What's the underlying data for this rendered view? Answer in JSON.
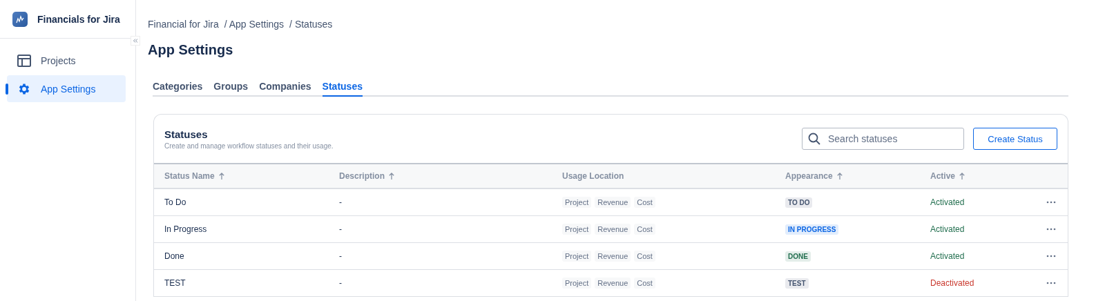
{
  "app": {
    "name": "Financials for Jira"
  },
  "sidebar": {
    "items": [
      {
        "label": "Projects",
        "selected": false
      },
      {
        "label": "App Settings",
        "selected": true
      }
    ]
  },
  "breadcrumbs": [
    "Financial for Jira",
    "/ App Settings",
    "/ Statuses"
  ],
  "page_title": "App Settings",
  "tabs": [
    {
      "label": "Categories",
      "selected": false
    },
    {
      "label": "Groups",
      "selected": false
    },
    {
      "label": "Companies",
      "selected": false
    },
    {
      "label": "Statuses",
      "selected": true
    }
  ],
  "card": {
    "title": "Statuses",
    "subtitle": "Create and manage workflow statuses and their usage.",
    "search": {
      "placeholder": "Search statuses"
    },
    "create_button": "Create Status"
  },
  "table": {
    "columns": [
      {
        "label": "Status Name",
        "sortable": true
      },
      {
        "label": "Description",
        "sortable": true
      },
      {
        "label": "Usage Location",
        "sortable": false
      },
      {
        "label": "Appearance",
        "sortable": true
      },
      {
        "label": "Active",
        "sortable": true
      }
    ],
    "rows": [
      {
        "name": "To Do",
        "description": "-",
        "usage": [
          "Project",
          "Revenue",
          "Cost"
        ],
        "appearance": {
          "label": "TO DO",
          "color": "#44546f"
        },
        "active": true,
        "active_label": "Activated"
      },
      {
        "name": "In Progress",
        "description": "-",
        "usage": [
          "Project",
          "Revenue",
          "Cost"
        ],
        "appearance": {
          "label": "IN PROGRESS",
          "color": "#0c66e4"
        },
        "active": true,
        "active_label": "Activated"
      },
      {
        "name": "Done",
        "description": "-",
        "usage": [
          "Project",
          "Revenue",
          "Cost"
        ],
        "appearance": {
          "label": "DONE",
          "color": "#216e4e"
        },
        "active": true,
        "active_label": "Activated"
      },
      {
        "name": "TEST",
        "description": "-",
        "usage": [
          "Project",
          "Revenue",
          "Cost"
        ],
        "appearance": {
          "label": "TEST",
          "color": "#44546f"
        },
        "active": false,
        "active_label": "Deactivated"
      }
    ]
  }
}
